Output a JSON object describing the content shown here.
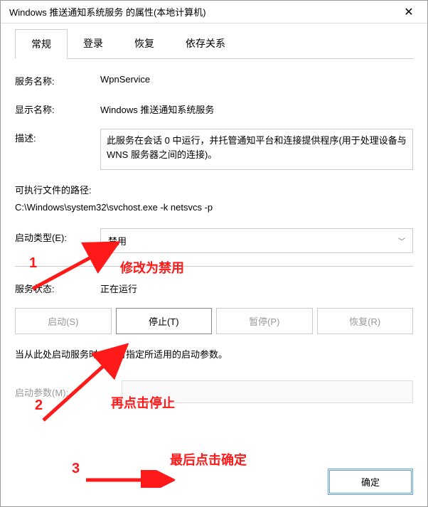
{
  "window": {
    "title": "Windows 推送通知系统服务 的属性(本地计算机)",
    "close": "✕"
  },
  "tabs": [
    {
      "label": "常规",
      "active": true
    },
    {
      "label": "登录",
      "active": false
    },
    {
      "label": "恢复",
      "active": false
    },
    {
      "label": "依存关系",
      "active": false
    }
  ],
  "fields": {
    "service_name_label": "服务名称:",
    "service_name_value": "WpnService",
    "display_name_label": "显示名称:",
    "display_name_value": "Windows 推送通知系统服务",
    "description_label": "描述:",
    "description_value": "此服务在会话 0 中运行，并托管通知平台和连接提供程序(用于处理设备与 WNS 服务器之间的连接)。",
    "path_label": "可执行文件的路径:",
    "path_value": "C:\\Windows\\system32\\svchost.exe -k netsvcs -p",
    "startup_type_label": "启动类型(E):",
    "startup_type_value": "禁用",
    "service_status_label": "服务状态:",
    "service_status_value": "正在运行"
  },
  "buttons": {
    "start": "启动(S)",
    "stop": "停止(T)",
    "pause": "暂停(P)",
    "resume": "恢复(R)",
    "ok": "确定"
  },
  "hint": "当从此处启动服务时，你可指定所适用的启动参数。",
  "param_label": "启动参数(M):",
  "annotations": {
    "n1": "1",
    "n2": "2",
    "n3": "3",
    "t1": "修改为禁用",
    "t2": "再点击停止",
    "t3": "最后点击确定"
  }
}
